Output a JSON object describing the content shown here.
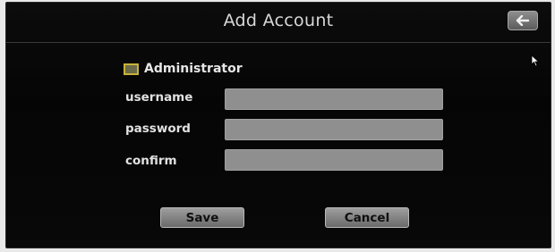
{
  "header": {
    "title": "Add Account",
    "back_icon": "arrow-left-icon"
  },
  "form": {
    "admin_checkbox": {
      "label": "Administrator",
      "checked": false
    },
    "username": {
      "label": "username",
      "value": ""
    },
    "password": {
      "label": "password",
      "value": ""
    },
    "confirm": {
      "label": "confirm",
      "value": ""
    }
  },
  "buttons": {
    "save_label": "Save",
    "cancel_label": "Cancel"
  },
  "colors": {
    "background": "#050505",
    "input": "#8f8f8f",
    "checkbox_border": "#c7b33a",
    "text": "#e1e1e1"
  }
}
